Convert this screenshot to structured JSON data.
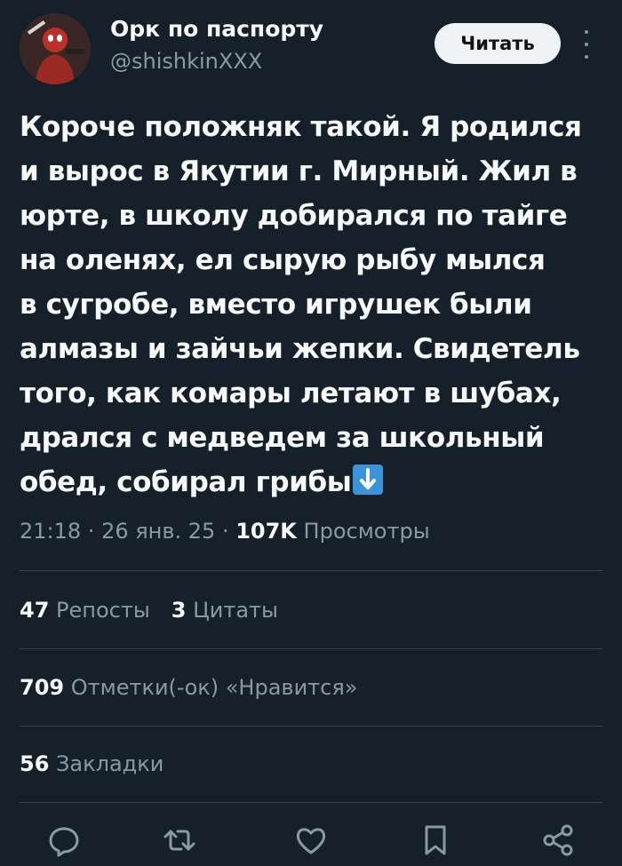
{
  "author": {
    "display_name": "Орк по паспорту",
    "handle": "@shishkinXXX"
  },
  "follow_button": {
    "label": "Читать"
  },
  "tweet": {
    "lines": [
      "Короче положняк такой. Я родился",
      "и вырос в Якутии г. Мирный. Жил в",
      "юрте, в школу добирался по тайге",
      "на оленях, ел сырую рыбу мылся",
      "в сугробе, вместо игрушек были",
      "алмазы и зайчьи жепки. Свидетель",
      "того, как комары летают в шубах,",
      "дрался с медведем за школьный",
      "обед, собирал грибы"
    ],
    "emoji": "down-arrow-emoji"
  },
  "meta": {
    "time": "21:18",
    "sep1": " · ",
    "date": "26 янв. 25",
    "sep2": " · ",
    "views_count": "107K",
    "views_label": " Просмотры"
  },
  "stats": {
    "reposts": {
      "count": "47",
      "label": " Репосты"
    },
    "quotes": {
      "count": "3",
      "label": " Цитаты"
    },
    "likes": {
      "count": "709",
      "label": " Отметки(-ок) «Нравится»"
    },
    "bookmarks": {
      "count": "56",
      "label": " Закладки"
    }
  },
  "actions": [
    "reply-icon",
    "retweet-icon",
    "like-icon",
    "bookmark-icon",
    "share-icon"
  ],
  "colors": {
    "background": "#15202b",
    "text": "#f7f9f9",
    "secondary": "#8b98a5",
    "divider": "#38444d"
  }
}
